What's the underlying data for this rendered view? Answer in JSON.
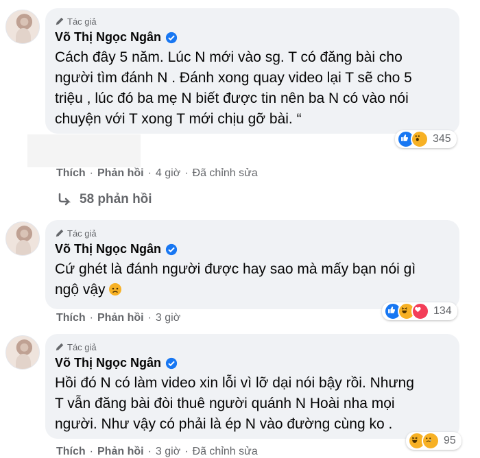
{
  "comments": [
    {
      "badge": "Tác giả",
      "author": "Võ Thị Ngọc Ngân",
      "lines": [
        "Cách đây 5 năm. Lúc N mới vào sg. T có đăng bài cho",
        "người tìm đánh N . Đánh xong quay video lại T sẽ cho 5",
        "triệu , lúc đó ba mẹ N biết được tin nên ba N có vào nói",
        "chuyện với T xong T mới chịu gỡ bài. “"
      ],
      "reactions": [
        "like-icon",
        "wow-icon"
      ],
      "reaction_count": "345",
      "actions": {
        "like": "Thích",
        "reply": "Phản hồi",
        "time": "4 giờ",
        "edited": "Đã chỉnh sửa"
      }
    },
    {
      "badge": "Tác giả",
      "author": "Võ Thị Ngọc Ngân",
      "lines": [
        "Cứ ghét là đánh người được hay sao mà mấy bạn nói gì",
        "ngộ vậy"
      ],
      "reactions": [
        "like-icon",
        "haha-icon",
        "love-icon"
      ],
      "reaction_count": "134",
      "actions": {
        "like": "Thích",
        "reply": "Phản hồi",
        "time": "3 giờ"
      }
    },
    {
      "badge": "Tác giả",
      "author": "Võ Thị Ngọc Ngân",
      "lines": [
        "Hồi đó N có làm video xin lỗi vì lỡ dại nói bậy rồi. Nhưng",
        "T vẫn đăng bài đòi thuê người quánh N Hoài nha mọi",
        "người. Như vậy có phải là ép N vào đường cùng ko ."
      ],
      "reactions": [
        "haha-icon",
        "sad-icon"
      ],
      "reaction_count": "95",
      "actions": {
        "like": "Thích",
        "reply": "Phản hồi",
        "time": "3 giờ",
        "edited": "Đã chỉnh sửa"
      }
    }
  ],
  "replies_label": "58 phản hồi",
  "colors": {
    "bubble": "#f0f2f5",
    "verified": "#1877f2",
    "muted": "#65676b"
  }
}
